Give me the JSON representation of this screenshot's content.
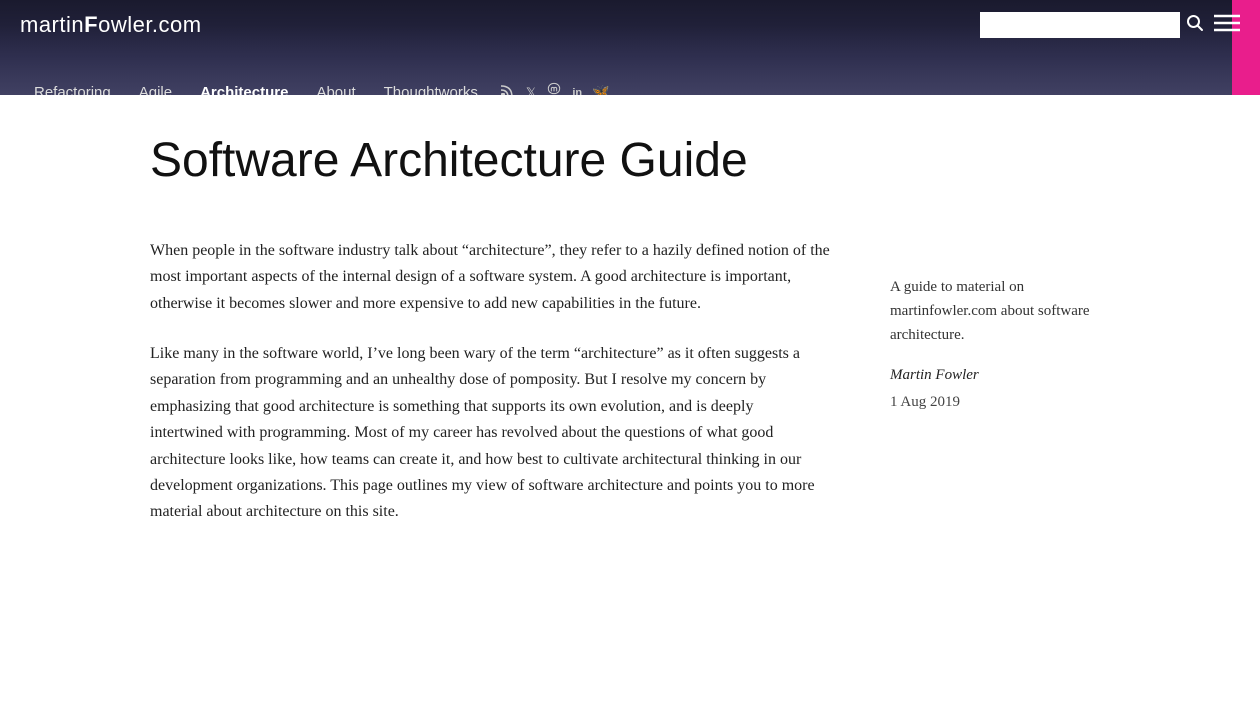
{
  "header": {
    "logo": "martin",
    "logo_bold": "F",
    "logo_rest": "owler.com",
    "search_placeholder": "",
    "search_button_label": "🔍"
  },
  "nav": {
    "links": [
      {
        "label": "Refactoring",
        "href": "#",
        "active": false
      },
      {
        "label": "Agile",
        "href": "#",
        "active": false
      },
      {
        "label": "Architecture",
        "href": "#",
        "active": true
      },
      {
        "label": "About",
        "href": "#",
        "active": false
      },
      {
        "label": "Thoughtworks",
        "href": "#",
        "active": false
      }
    ],
    "social": [
      {
        "name": "rss",
        "symbol": "⊕",
        "label": "RSS"
      },
      {
        "name": "twitter",
        "symbol": "𝕏",
        "label": "Twitter"
      },
      {
        "name": "mastodon",
        "symbol": "🐘",
        "label": "Mastodon"
      },
      {
        "name": "linkedin",
        "symbol": "in",
        "label": "LinkedIn"
      },
      {
        "name": "bluesky",
        "symbol": "🦋",
        "label": "Bluesky"
      }
    ]
  },
  "article": {
    "title": "Software Architecture Guide",
    "paragraphs": [
      "When people in the software industry talk about “architecture”, they refer to a hazily defined notion of the most important aspects of the internal design of a software system. A good architecture is important, otherwise it becomes slower and more expensive to add new capabilities in the future.",
      "Like many in the software world, I’ve long been wary of the term “architecture” as it often suggests a separation from programming and an unhealthy dose of pomposity. But I resolve my concern by emphasizing that good architecture is something that supports its own evolution, and is deeply intertwined with programming. Most of my career has revolved about the questions of what good architecture looks like, how teams can create it, and how best to cultivate architectural thinking in our development organizations. This page outlines my view of software architecture and points you to more material about architecture on this site."
    ]
  },
  "sidebar": {
    "summary": "A guide to material on martinfowler.com about software architecture.",
    "author": "Martin Fowler",
    "date": "1 Aug 2019"
  }
}
